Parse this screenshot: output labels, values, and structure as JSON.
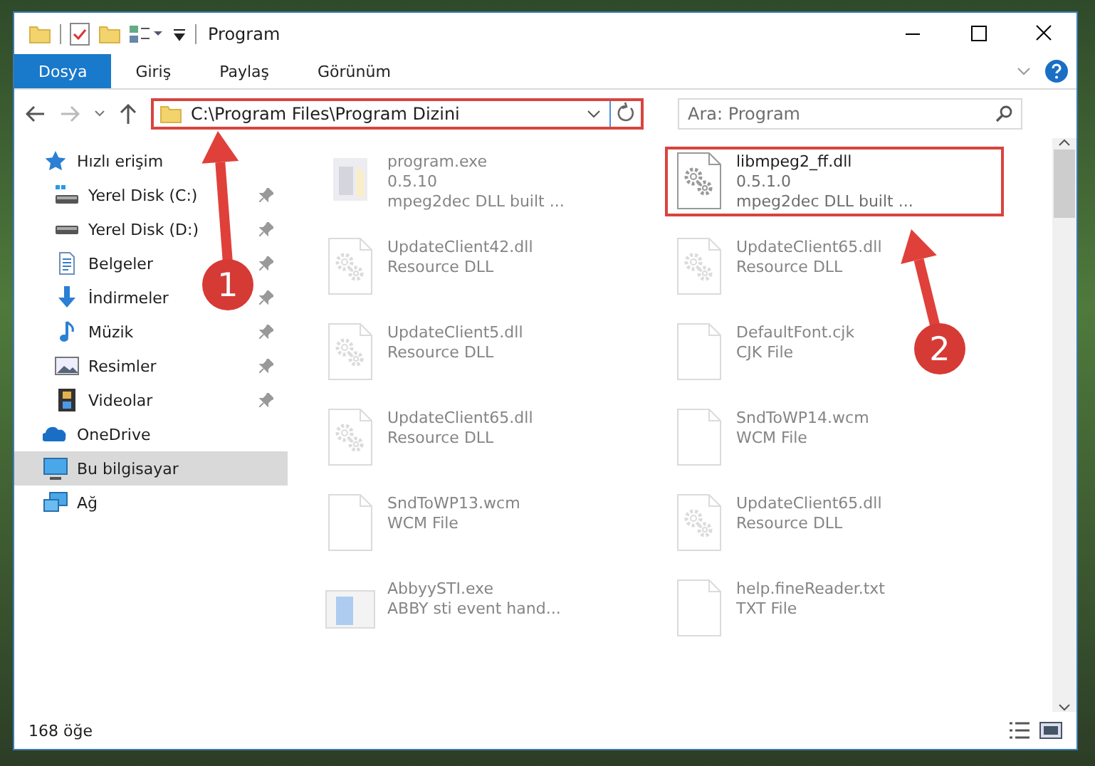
{
  "window": {
    "title": "Program"
  },
  "ribbon_tabs": [
    {
      "label": "Dosya",
      "selected": true
    },
    {
      "label": "Giriş",
      "selected": false
    },
    {
      "label": "Paylaş",
      "selected": false
    },
    {
      "label": "Görünüm",
      "selected": false
    }
  ],
  "address_bar": {
    "path": "C:\\Program Files\\Program Dizini",
    "highlighted": true
  },
  "search": {
    "placeholder": "Ara: Program"
  },
  "sidebar": {
    "items": [
      {
        "label": "Hızlı erişim",
        "kind": "star",
        "pinned": false,
        "selected": false,
        "children": [
          {
            "label": "Yerel Disk (C:)",
            "kind": "system-drive",
            "pinned": true,
            "selected": false
          },
          {
            "label": "Yerel Disk (D:)",
            "kind": "drive",
            "pinned": true,
            "selected": false
          },
          {
            "label": "Belgeler",
            "kind": "documents",
            "pinned": true,
            "selected": false
          },
          {
            "label": "İndirmeler",
            "kind": "downloads",
            "pinned": true,
            "selected": false
          },
          {
            "label": "Müzik",
            "kind": "music",
            "pinned": true,
            "selected": false
          },
          {
            "label": "Resimler",
            "kind": "pictures",
            "pinned": true,
            "selected": false
          },
          {
            "label": "Videolar",
            "kind": "videos",
            "pinned": true,
            "selected": false
          }
        ]
      },
      {
        "label": "OneDrive",
        "kind": "cloud",
        "pinned": false,
        "selected": false
      },
      {
        "label": "Bu bilgisayar",
        "kind": "computer",
        "pinned": false,
        "selected": true
      },
      {
        "label": "Ağ",
        "kind": "network",
        "pinned": false,
        "selected": false
      }
    ]
  },
  "files": [
    {
      "name": "program.exe",
      "details": [
        "0.5.10",
        "mpeg2dec DLL built ..."
      ],
      "kind": "exe",
      "faded": true,
      "highlighted": false
    },
    {
      "name": "libmpeg2_ff.dll",
      "details": [
        "0.5.1.0",
        "mpeg2dec DLL built ..."
      ],
      "kind": "dll",
      "faded": false,
      "highlighted": true
    },
    {
      "name": "UpdateClient42.dll",
      "details": [
        "Resource DLL"
      ],
      "kind": "dll",
      "faded": true,
      "highlighted": false
    },
    {
      "name": "UpdateClient65.dll",
      "details": [
        "Resource DLL"
      ],
      "kind": "dll",
      "faded": true,
      "highlighted": false
    },
    {
      "name": "UpdateClient5.dll",
      "details": [
        "Resource DLL"
      ],
      "kind": "dll",
      "faded": true,
      "highlighted": false
    },
    {
      "name": "DefaultFont.cjk",
      "details": [
        "CJK File"
      ],
      "kind": "blank",
      "faded": true,
      "highlighted": false
    },
    {
      "name": "UpdateClient65.dll",
      "details": [
        "Resource DLL"
      ],
      "kind": "dll",
      "faded": true,
      "highlighted": false
    },
    {
      "name": "SndToWP14.wcm",
      "details": [
        "WCM File"
      ],
      "kind": "blank",
      "faded": true,
      "highlighted": false
    },
    {
      "name": "SndToWP13.wcm",
      "details": [
        "WCM File"
      ],
      "kind": "blank",
      "faded": true,
      "highlighted": false
    },
    {
      "name": "UpdateClient65.dll",
      "details": [
        "Resource DLL"
      ],
      "kind": "dll",
      "faded": true,
      "highlighted": false
    },
    {
      "name": "AbbyySTI.exe",
      "details": [
        "ABBY sti event hand..."
      ],
      "kind": "app",
      "faded": true,
      "highlighted": false
    },
    {
      "name": "help.fineReader.txt",
      "details": [
        "TXT File"
      ],
      "kind": "blank",
      "faded": true,
      "highlighted": false
    }
  ],
  "status_bar": {
    "item_count": "168 öğe"
  },
  "annotations": [
    {
      "label": "1"
    },
    {
      "label": "2"
    }
  ]
}
